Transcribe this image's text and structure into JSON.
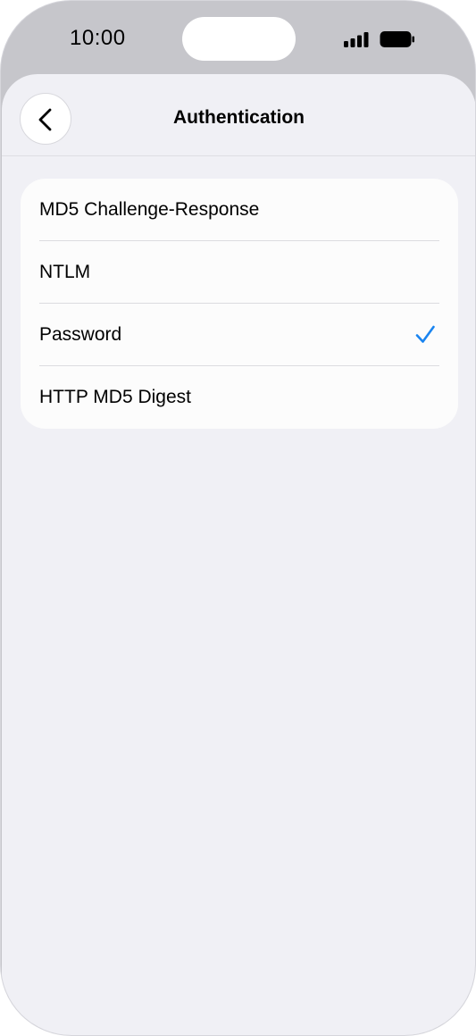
{
  "status_bar": {
    "time": "10:00",
    "signal_icon": "cellular-signal-icon",
    "battery_icon": "battery-full-icon"
  },
  "nav": {
    "title": "Authentication",
    "back_icon": "chevron-left-icon"
  },
  "options": [
    {
      "label": "MD5 Challenge-Response",
      "selected": false
    },
    {
      "label": "NTLM",
      "selected": false
    },
    {
      "label": "Password",
      "selected": true
    },
    {
      "label": "HTTP MD5 Digest",
      "selected": false
    }
  ],
  "colors": {
    "accent": "#1a84f0",
    "background": "#f0f0f5",
    "card": "#fcfcfc"
  }
}
